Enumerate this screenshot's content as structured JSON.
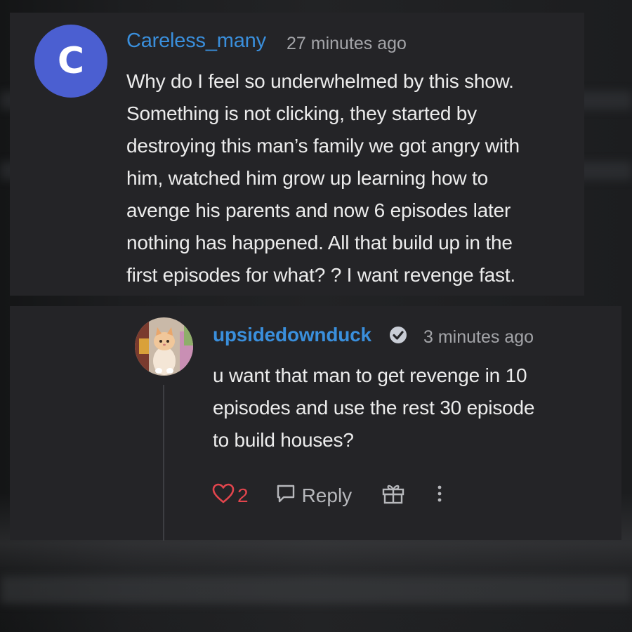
{
  "comment": {
    "avatar_letter": "C",
    "avatar_color": "#4b5fd1",
    "username": "Careless_many",
    "time": "27 minutes ago",
    "lines": [
      "Why do I feel so underwhelmed by this show.",
      "Something is not clicking, they started by",
      "destroying this man’s family we got angry with",
      "him, watched him grow up learning how to",
      "avenge his parents and now 6 episodes later",
      "nothing has happened. All that build up in the",
      "first episodes for what? ? I want revenge fast."
    ]
  },
  "reply": {
    "avatar_icon": "kitten-avatar",
    "username": "upsidedownduck",
    "verified_icon": "verified-check-icon",
    "time": "3 minutes ago",
    "lines": [
      "u want that man to get revenge in 10",
      "episodes and use the rest 30 episode",
      "to build houses?"
    ],
    "actions": {
      "like_icon": "heart-icon",
      "like_count": "2",
      "reply_icon": "comment-icon",
      "reply_label": "Reply",
      "gift_icon": "gift-icon",
      "more_icon": "more-vertical-icon"
    }
  },
  "colors": {
    "username": "#3a8fdc",
    "like": "#e2454d",
    "card": "#242427"
  }
}
